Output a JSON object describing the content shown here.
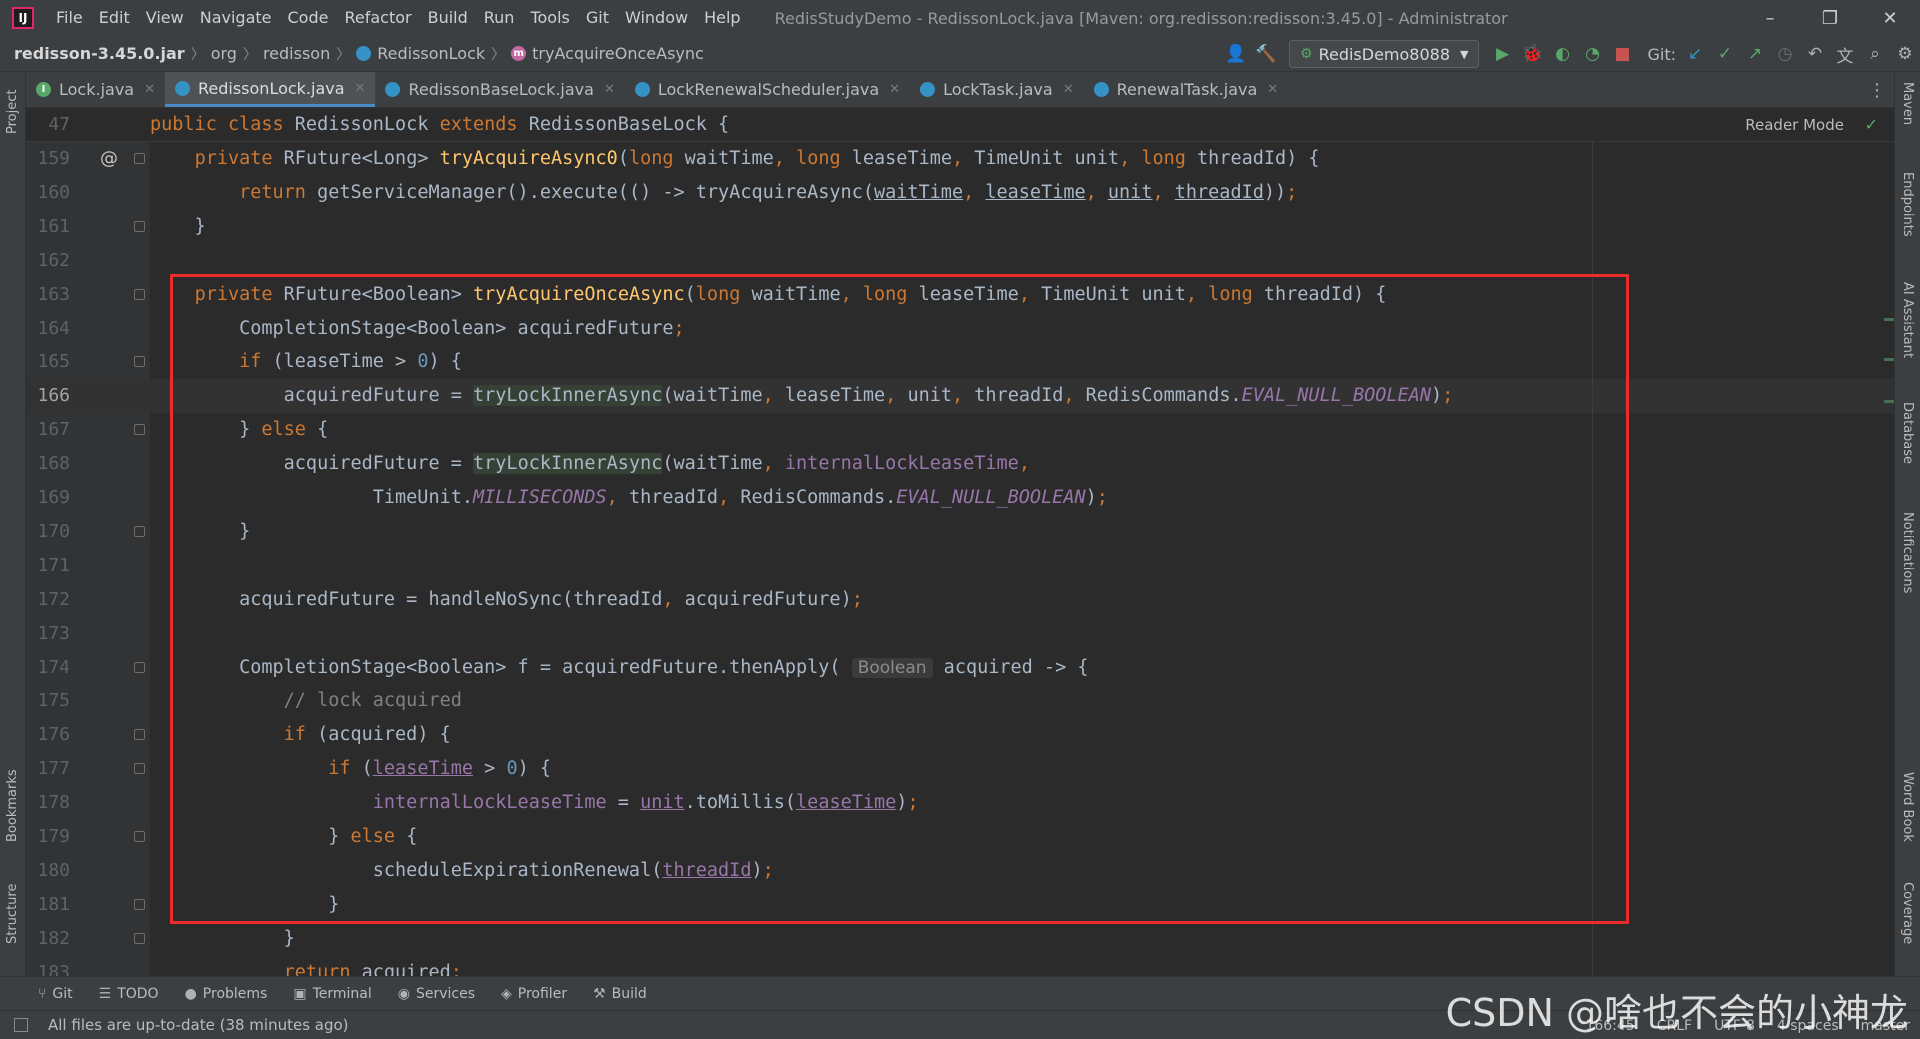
{
  "window": {
    "title": "RedisStudyDemo - RedissonLock.java [Maven: org.redisson:redisson:3.45.0] - Administrator",
    "controls": [
      "–",
      "❐",
      "✕"
    ]
  },
  "menu": [
    "File",
    "Edit",
    "View",
    "Navigate",
    "Code",
    "Refactor",
    "Build",
    "Run",
    "Tools",
    "Git",
    "Window",
    "Help"
  ],
  "breadcrumb": {
    "jar": "redisson-3.45.0.jar",
    "pkg1": "org",
    "pkg2": "redisson",
    "cls": "RedissonLock",
    "method": "tryAcquireOnceAsync"
  },
  "toolbar": {
    "run_config": "RedisDemo8088",
    "git_label": "Git:"
  },
  "tabs": [
    {
      "label": "Lock.java",
      "icon_color": "#59a869",
      "icon_letter": "I",
      "active": false
    },
    {
      "label": "RedissonLock.java",
      "icon_color": "#3592c4",
      "icon_letter": "",
      "active": true
    },
    {
      "label": "RedissonBaseLock.java",
      "icon_color": "#3592c4",
      "icon_letter": "",
      "active": false
    },
    {
      "label": "LockRenewalScheduler.java",
      "icon_color": "#3592c4",
      "icon_letter": "",
      "active": false
    },
    {
      "label": "LockTask.java",
      "icon_color": "#3592c4",
      "icon_letter": "",
      "active": false
    },
    {
      "label": "RenewalTask.java",
      "icon_color": "#3592c4",
      "icon_letter": "",
      "active": false
    }
  ],
  "editor": {
    "reader_mode": "Reader Mode",
    "sticky_line_number": "47",
    "sticky_line": "public class RedissonLock extends RedissonBaseLock {",
    "line_numbers": [
      "159",
      "160",
      "161",
      "162",
      "163",
      "164",
      "165",
      "166",
      "167",
      "168",
      "169",
      "170",
      "171",
      "172",
      "173",
      "174",
      "175",
      "176",
      "177",
      "178",
      "179",
      "180",
      "181",
      "182",
      "183"
    ],
    "hint_label": "Boolean"
  },
  "left_tools": [
    "Project",
    "Bookmarks",
    "Structure"
  ],
  "right_tools": [
    "Maven",
    "Endpoints",
    "AI Assistant",
    "Database",
    "Notifications",
    "Word Book",
    "Coverage"
  ],
  "bottom_tools": [
    {
      "label": "Git",
      "icon": "branch-icon"
    },
    {
      "label": "TODO",
      "icon": "list-icon"
    },
    {
      "label": "Problems",
      "icon": "info-icon"
    },
    {
      "label": "Terminal",
      "icon": "terminal-icon"
    },
    {
      "label": "Services",
      "icon": "services-icon"
    },
    {
      "label": "Profiler",
      "icon": "profiler-icon"
    },
    {
      "label": "Build",
      "icon": "hammer-icon"
    }
  ],
  "status": {
    "message": "All files are up-to-date (38 minutes ago)",
    "position": "166:45",
    "line_sep": "CRLF",
    "encoding": "UTF-8",
    "indent": "4 spaces",
    "branch": "master"
  },
  "watermark": "CSDN @啥也不会的小神龙"
}
